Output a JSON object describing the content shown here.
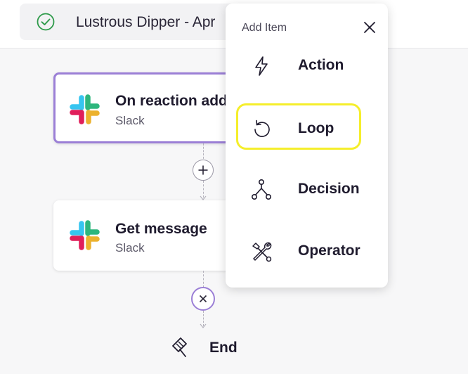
{
  "header": {
    "workflow_title": "Lustrous Dipper - Apr",
    "status_icon": "check-circle-icon",
    "status_color": "#2e9a4a"
  },
  "nodes": [
    {
      "name": "On reaction add",
      "app": "Slack",
      "icon": "slack-logo",
      "selected": true
    },
    {
      "name": "Get message",
      "app": "Slack",
      "icon": "slack-logo",
      "selected": false
    }
  ],
  "end_node": {
    "label": "End",
    "icon": "end-flag-icon"
  },
  "add_item_menu": {
    "title": "Add Item",
    "close_icon": "close-icon",
    "items": [
      {
        "label": "Action",
        "icon": "lightning-icon"
      },
      {
        "label": "Loop",
        "icon": "loop-icon",
        "highlighted": true
      },
      {
        "label": "Decision",
        "icon": "decision-icon"
      },
      {
        "label": "Operator",
        "icon": "tools-icon"
      }
    ]
  },
  "colors": {
    "accent": "#9b7fd6",
    "highlight": "#f5ee2b"
  }
}
